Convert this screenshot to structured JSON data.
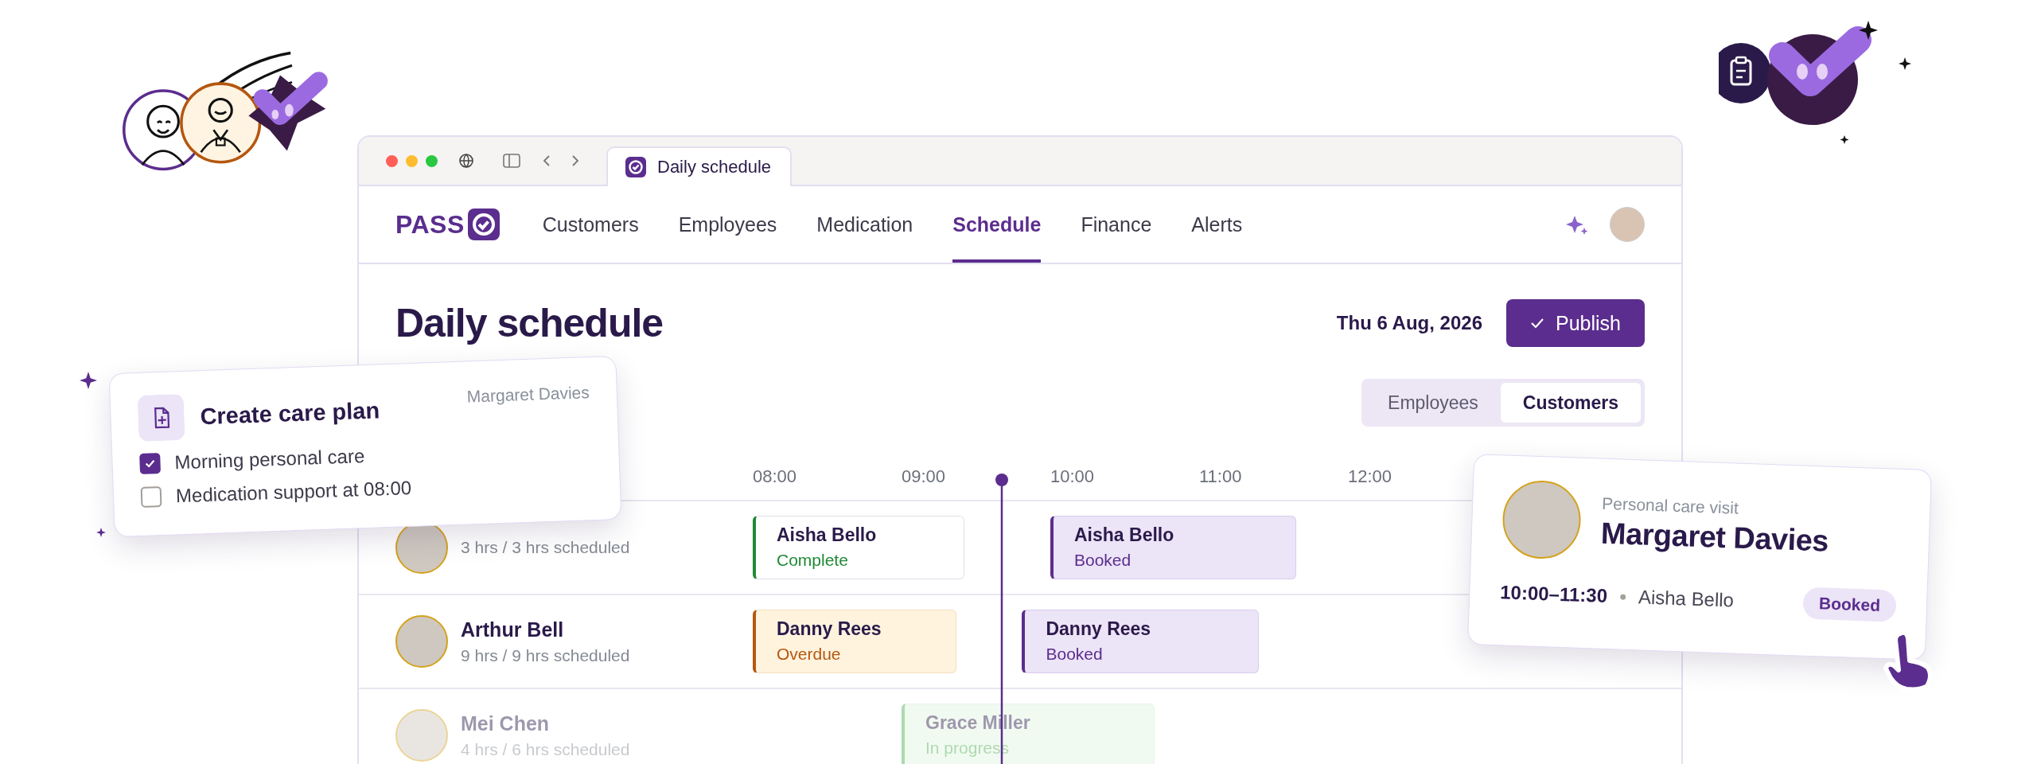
{
  "browser": {
    "tab_title": "Daily schedule"
  },
  "nav": {
    "logo": "PASS",
    "items": [
      {
        "label": "Customers",
        "selected": false
      },
      {
        "label": "Employees",
        "selected": false
      },
      {
        "label": "Medication",
        "selected": false
      },
      {
        "label": "Schedule",
        "selected": true
      },
      {
        "label": "Finance",
        "selected": false
      },
      {
        "label": "Alerts",
        "selected": false
      }
    ]
  },
  "page": {
    "title": "Daily schedule",
    "date": "Thu 6 Aug, 2026",
    "publish_button": "Publish"
  },
  "view_toggle": [
    {
      "label": "Employees",
      "selected": false
    },
    {
      "label": "Customers",
      "selected": true
    }
  ],
  "timeline": {
    "hours": [
      "08:00",
      "09:00",
      "10:00",
      "11:00",
      "12:00"
    ],
    "rows": [
      {
        "detail": "3 hrs / 3 hrs scheduled",
        "visits": [
          {
            "employee": "Aisha Bello",
            "status": "Complete",
            "kind": "complete"
          },
          {
            "employee": "Aisha Bello",
            "status": "Booked",
            "kind": "booked"
          }
        ]
      },
      {
        "name": "Arthur Bell",
        "detail": "9 hrs / 9 hrs scheduled",
        "visits": [
          {
            "employee": "Danny Rees",
            "status": "Overdue",
            "kind": "overdue"
          },
          {
            "employee": "Danny Rees",
            "status": "Booked",
            "kind": "booked"
          }
        ]
      },
      {
        "name": "Mei Chen",
        "detail": "4 hrs / 6 hrs scheduled",
        "visits": [
          {
            "employee": "Grace Miller",
            "status": "In progress",
            "kind": "in_progress"
          }
        ]
      }
    ]
  },
  "care_plan_card": {
    "title": "Create care plan",
    "customer": "Margaret Davies",
    "tasks": [
      {
        "label": "Morning personal care",
        "checked": true
      },
      {
        "label": "Medication support at 08:00",
        "checked": false
      }
    ]
  },
  "visit_card": {
    "type": "Personal care visit",
    "customer": "Margaret Davies",
    "time": "10:00–11:30",
    "employee": "Aisha Bello",
    "status": "Booked",
    "kind": "booked"
  }
}
